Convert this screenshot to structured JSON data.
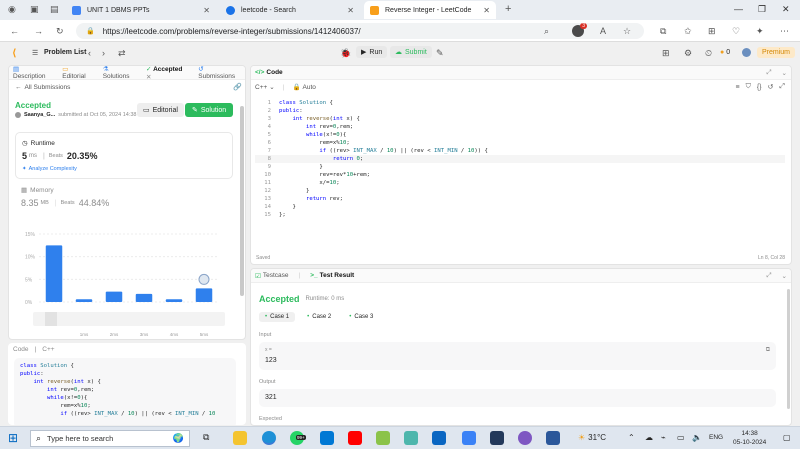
{
  "browser": {
    "tabs": [
      {
        "title": "UNIT 1 DBMS PPTs",
        "color": "#4285f4"
      },
      {
        "title": "leetcode - Search",
        "color": "#1a73e8"
      },
      {
        "title": "Reverse Integer - LeetCode",
        "color": "#f89f1b"
      }
    ],
    "url": "https://leetcode.com/problems/reverse-integer/submissions/1412406037/",
    "ext_badge": "3"
  },
  "header": {
    "problem_list": "Problem List",
    "run": "Run",
    "submit": "Submit",
    "coins": "0",
    "premium": "Premium"
  },
  "left": {
    "tabs": [
      "Description",
      "Editorial",
      "Solutions",
      "Accepted",
      "Submissions"
    ],
    "all_submissions": "All Submissions",
    "status": "Accepted",
    "user": "Saanya_G...",
    "submitted": "submitted at Oct 05, 2024 14:38",
    "editorial_btn": "Editorial",
    "solution_btn": "Solution",
    "runtime_label": "Runtime",
    "runtime_value": "5",
    "runtime_unit": "ms",
    "beats_label": "Beats",
    "runtime_beats": "20.35%",
    "analyze": "Analyze Complexity",
    "memory_label": "Memory",
    "memory_value": "8.35",
    "memory_unit": "MB",
    "memory_beats": "44.84%",
    "code_label": "Code",
    "lang_label": "C++"
  },
  "chart_data": {
    "type": "bar",
    "y_ticks": [
      "15%",
      "10%",
      "5%",
      "0%"
    ],
    "ylim": [
      0,
      15
    ],
    "x_labels": [
      "1ms",
      "2ms",
      "3ms",
      "4ms",
      "5ms"
    ],
    "values": [
      12.5,
      0.6,
      2.3,
      1.8,
      0.6,
      3.0
    ],
    "bar_color": "#2f80ed"
  },
  "editor": {
    "title": "Code",
    "language": "C++",
    "mode": "Auto",
    "lines": [
      "class Solution {",
      "public:",
      "    int reverse(int x) {",
      "        int rev=0,rem;",
      "        while(x!=0){",
      "            rem=x%10;",
      "            if ((rev> INT_MAX / 10) || (rev < INT_MIN / 10)) {",
      "                return 0;",
      "            }",
      "            rev=rev*10+rem;",
      "            x/=10;",
      "        }",
      "        return rev;",
      "    }",
      "};"
    ],
    "saved": "Saved",
    "cursor": "Ln 8, Col 28"
  },
  "test": {
    "tab1": "Testcase",
    "tab2": "Test Result",
    "status": "Accepted",
    "runtime": "Runtime: 0 ms",
    "cases": [
      "Case 1",
      "Case 2",
      "Case 3"
    ],
    "input_label": "Input",
    "input_var": "x =",
    "input_value": "123",
    "output_label": "Output",
    "output_value": "321",
    "expected_label": "Expected"
  },
  "bottom_code": [
    "class Solution {",
    "public:",
    "    int reverse(int x) {",
    "        int rev=0,rem;",
    "        while(x!=0){",
    "            rem=x%10;",
    "            if ((rev> INT_MAX / 10) || (rev < INT_MIN / 10"
  ],
  "taskbar": {
    "search_placeholder": "Type here to search",
    "weather": "31°C",
    "lang": "ENG",
    "time": "14:38",
    "date": "05-10-2024",
    "badge": "99+"
  }
}
